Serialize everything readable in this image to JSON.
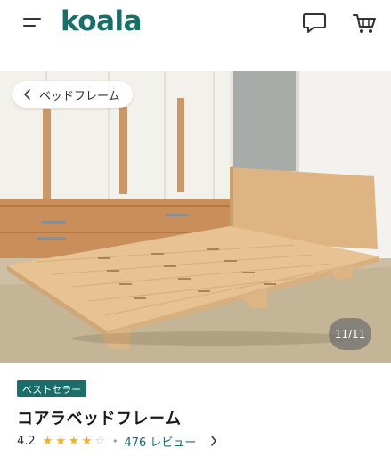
{
  "header": {
    "logo_text": "koala",
    "brand_color": "#1a6e6a",
    "menu_icon": "hamburger-icon",
    "chat_icon": "chat-bubble-icon",
    "cart_icon": "shopping-cart-icon"
  },
  "gallery": {
    "back_label": "ベッドフレーム",
    "counter": "11/11"
  },
  "product": {
    "badge": "ベストセラー",
    "title": "コアラベッドフレーム",
    "rating_value": "4.2",
    "stars_filled": 4,
    "stars_total": 5,
    "reviews": "476 レビュー"
  }
}
